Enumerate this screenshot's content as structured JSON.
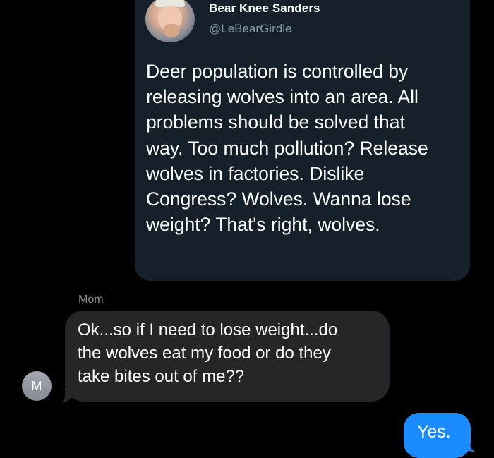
{
  "tweet": {
    "display_name": "Bear Knee Sanders",
    "handle": "@LeBearGirdle",
    "text": "Deer population is controlled by\nreleasing wolves into an area. All\nproblems should be solved that\nway. Too much pollution? Release\nwolves in factories. Dislike\nCongress? Wolves. Wanna lose\nweight? That's right, wolves."
  },
  "thread": {
    "sender_name": "Mom",
    "contact_initial": "M",
    "incoming_message": "Ok...so if I need to lose weight...do\nthe wolves eat my food or do they\ntake bites out of me??",
    "outgoing_message": "Yes."
  },
  "colors": {
    "background": "#000000",
    "tweet_card": "#15202b",
    "incoming_bubble": "#262628",
    "outgoing_bubble": "#1a8cff",
    "secondary_text": "#8e8e93"
  }
}
